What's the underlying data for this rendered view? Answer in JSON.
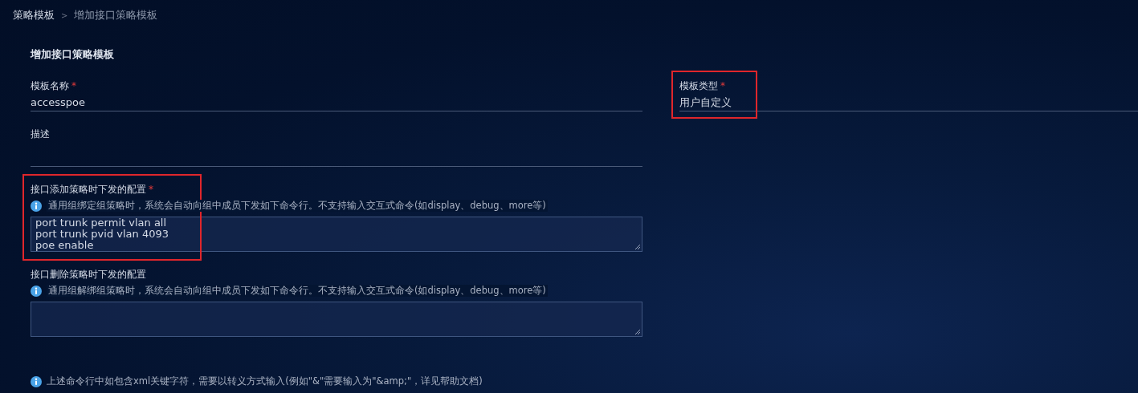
{
  "breadcrumb": {
    "separator": ">",
    "items": [
      {
        "label": "策略模板",
        "current": false
      },
      {
        "label": "增加接口策略模板",
        "current": true
      }
    ]
  },
  "form": {
    "title": "增加接口策略模板",
    "required_mark": "*",
    "fields": [
      {
        "kind": "text",
        "label": "模板名称",
        "required": true,
        "value": "accesspoe",
        "highlighted": false
      },
      {
        "kind": "text",
        "label": "模板类型",
        "required": true,
        "value": "用户自定义",
        "highlighted": true
      },
      {
        "kind": "text",
        "label": "描述",
        "required": false,
        "highlighted": false
      },
      {
        "kind": "commands",
        "label": "接口添加策略时下发的配置",
        "required": true,
        "hint": "通用组绑定组策略时，系统会自动向组中成员下发如下命令行。不支持输入交互式命令(如display、debug、more等)",
        "value": "port trunk permit vlan all\nport trunk pvid vlan 4093\npoe enable",
        "highlighted": true
      },
      {
        "kind": "commands",
        "label": "接口删除策略时下发的配置",
        "required": false,
        "hint": "通用组解绑组策略时，系统会自动向组中成员下发如下命令行。不支持输入交互式命令(如display、debug、more等)",
        "highlighted": false
      }
    ],
    "note": "上述命令行中如包含xml关键字符，需要以转义方式输入(例如\"&\"需要输入为\"&amp;\"，详见帮助文档)"
  }
}
